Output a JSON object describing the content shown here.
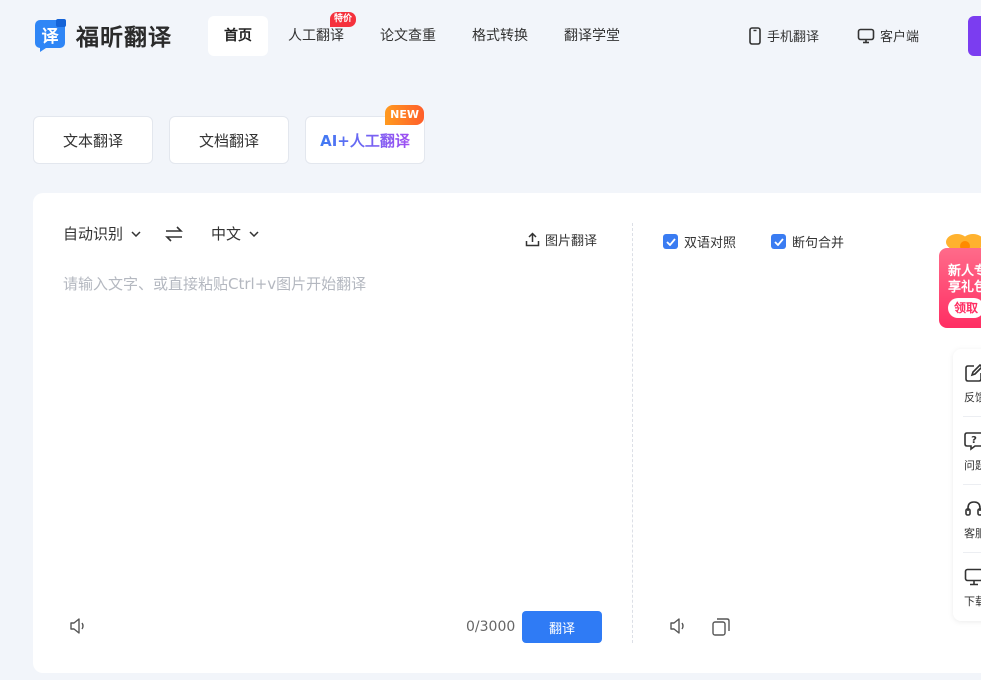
{
  "brand": {
    "logo_char": "译",
    "name": "福昕翻译"
  },
  "nav": {
    "items": [
      {
        "label": "首页",
        "active": true
      },
      {
        "label": "人工翻译",
        "badge": "特价"
      },
      {
        "label": "论文查重"
      },
      {
        "label": "格式转换"
      },
      {
        "label": "翻译学堂"
      }
    ]
  },
  "header_links": {
    "mobile": "手机翻译",
    "client": "客户端"
  },
  "mode_tabs": {
    "text": "文本翻译",
    "document": "文档翻译",
    "ai_human": "AI+人工翻译",
    "ai_badge": "NEW"
  },
  "translator": {
    "source_lang": "自动识别",
    "target_lang": "中文",
    "image_translate": "图片翻译",
    "placeholder": "请输入文字、或直接粘贴Ctrl+v图片开始翻译",
    "input_value": "",
    "counter": "0/3000",
    "translate_button": "翻译",
    "bilingual": "双语对照",
    "merge_sentences": "断句合并"
  },
  "promo": {
    "line1": "新人专",
    "line2": "享礼包",
    "button": "领取"
  },
  "sidebar": {
    "items": [
      {
        "label": "反馈",
        "icon": "edit-icon"
      },
      {
        "label": "问题",
        "icon": "question-icon"
      },
      {
        "label": "客服",
        "icon": "headset-icon"
      },
      {
        "label": "下载",
        "icon": "monitor-icon"
      }
    ]
  },
  "colors": {
    "primary": "#2f7bf5",
    "accent_purple": "#7b3df0",
    "badge_red": "#f5313c",
    "new_orange": "#ff7a22",
    "promo_pink": "#ff2e63"
  }
}
